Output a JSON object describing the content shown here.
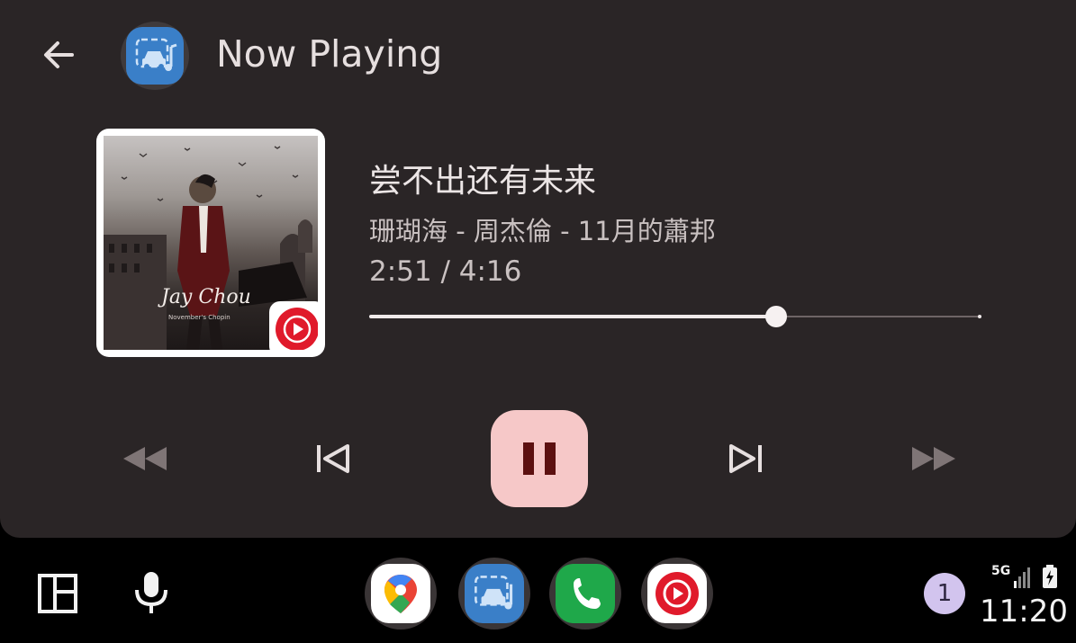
{
  "header": {
    "title": "Now Playing",
    "back_icon": "arrow-back-icon",
    "app_icon": "car-music-icon"
  },
  "track": {
    "title": "尝不出还有未来",
    "subtitle": "珊瑚海 - 周杰倫 - 11月的蕭邦",
    "time": "2:51 / 4:16",
    "progress": 0.664,
    "album_art": {
      "artist_script": "Jay Chou",
      "source_badge_icon": "youtube-music-icon"
    }
  },
  "controls": {
    "rewind_icon": "fast-rewind-icon",
    "previous_icon": "skip-previous-icon",
    "pause_icon": "pause-icon",
    "next_icon": "skip-next-icon",
    "forward_icon": "fast-forward-icon"
  },
  "dock": {
    "apps": [
      {
        "name": "maps-app-icon"
      },
      {
        "name": "car-music-app-icon"
      },
      {
        "name": "phone-app-icon"
      },
      {
        "name": "youtube-music-app-icon"
      }
    ]
  },
  "status": {
    "notification_count": "1",
    "network": "5G",
    "clock": "11:20"
  },
  "colors": {
    "panel": "#2a2526",
    "pause_button": "#f6c8c8",
    "pause_glyph": "#5c1010",
    "youtube_red": "#e01a2b",
    "app_blue": "#3a7fc8",
    "notification": "#d2c4ee"
  }
}
